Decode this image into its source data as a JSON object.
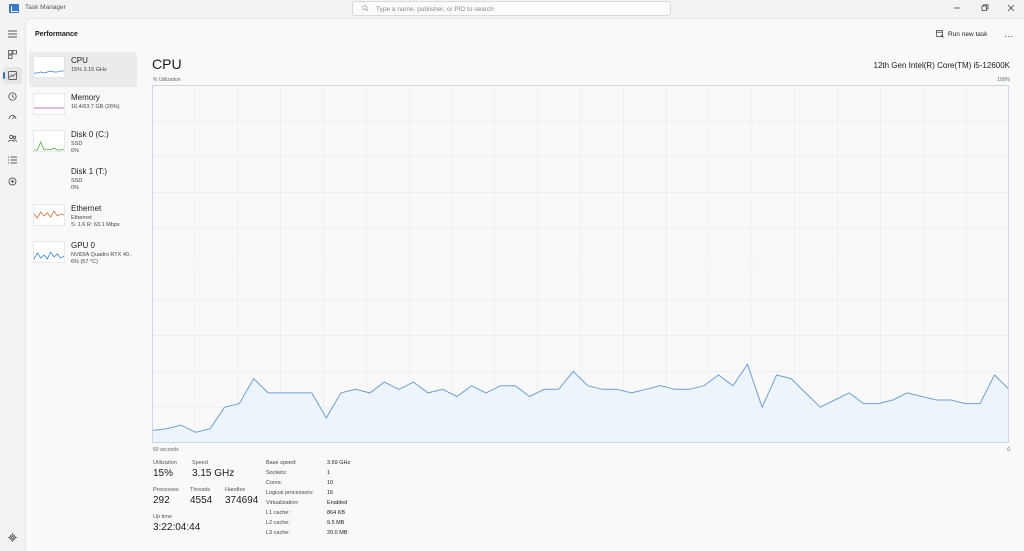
{
  "window": {
    "title": "Task Manager",
    "search_placeholder": "Type a name, publisher, or PID to search"
  },
  "header": {
    "page_title": "Performance",
    "run_new_task": "Run new task",
    "more": "..."
  },
  "devices": [
    {
      "name": "CPU",
      "line1": "15%  3.15 GHz",
      "line2": "",
      "line3": "",
      "thumb_color": "#3a85d4"
    },
    {
      "name": "Memory",
      "line1": "16.4/63.7 GB (26%)",
      "line2": "",
      "line3": "",
      "thumb_color": "#9b4fc4"
    },
    {
      "name": "Disk 0 (C:)",
      "line1": "SSD",
      "line2": "6%",
      "line3": "",
      "thumb_color": "#4fa83a"
    },
    {
      "name": "Disk 1 (T:)",
      "line1": "SSD",
      "line2": "0%",
      "line3": "",
      "thumb_color": "#4fa83a"
    },
    {
      "name": "Ethernet",
      "line1": "Ethernet",
      "line2": "S: 1.6  R: 63.1 Mbps",
      "line3": "",
      "thumb_color": "#c8743a"
    },
    {
      "name": "GPU 0",
      "line1": "NVIDIA Quadro RTX 40..",
      "line2": "6%  (57 °C)",
      "line3": "",
      "thumb_color": "#3a85d4"
    }
  ],
  "cpu": {
    "heading": "CPU",
    "model": "12th Gen Intel(R) Core(TM) i5-12600K",
    "graph_ylabel": "% Utilization",
    "graph_ymax": "100%",
    "graph_xlabel": "60 seconds",
    "graph_xmin": "0",
    "utilization_history": [
      3.5,
      4,
      5,
      3,
      4,
      10,
      11,
      18,
      14,
      14,
      14,
      14,
      7,
      14,
      15,
      14,
      17,
      15,
      17,
      14,
      15,
      13,
      16,
      14,
      16,
      16,
      13,
      15,
      15,
      20,
      16,
      15,
      15,
      14,
      15,
      16,
      15,
      15,
      16,
      19,
      16,
      22,
      10,
      19,
      18,
      14,
      10,
      12,
      14,
      11,
      11,
      12,
      14,
      13,
      12,
      12,
      11,
      11,
      19,
      15
    ],
    "line_color": "#6f9fd3",
    "fill_color": "#eef4fb"
  },
  "stats": {
    "utilization": {
      "label": "Utilization",
      "value": "15%"
    },
    "speed": {
      "label": "Speed",
      "value": "3.15 GHz"
    },
    "processes": {
      "label": "Processes",
      "value": "292"
    },
    "threads": {
      "label": "Threads",
      "value": "4554"
    },
    "handles": {
      "label": "Handles",
      "value": "374694"
    },
    "uptime": {
      "label": "Up time",
      "value": "3:22:04:44"
    }
  },
  "specs": [
    {
      "k": "Base speed:",
      "v": "3.69 GHz"
    },
    {
      "k": "Sockets:",
      "v": "1"
    },
    {
      "k": "Cores:",
      "v": "10"
    },
    {
      "k": "Logical processors:",
      "v": "16"
    },
    {
      "k": "Virtualization:",
      "v": "Enabled"
    },
    {
      "k": "L1 cache:",
      "v": "864 KB"
    },
    {
      "k": "L2 cache:",
      "v": "9.5 MB"
    },
    {
      "k": "L3 cache:",
      "v": "20.0 MB"
    }
  ],
  "icons": {
    "hamburger": "hamburger-icon",
    "processes": "processes-icon",
    "performance": "performance-icon",
    "app_history": "app-history-icon",
    "startup": "startup-apps-icon",
    "users": "users-icon",
    "details": "details-icon",
    "services": "services-icon",
    "settings": "gear-icon"
  }
}
